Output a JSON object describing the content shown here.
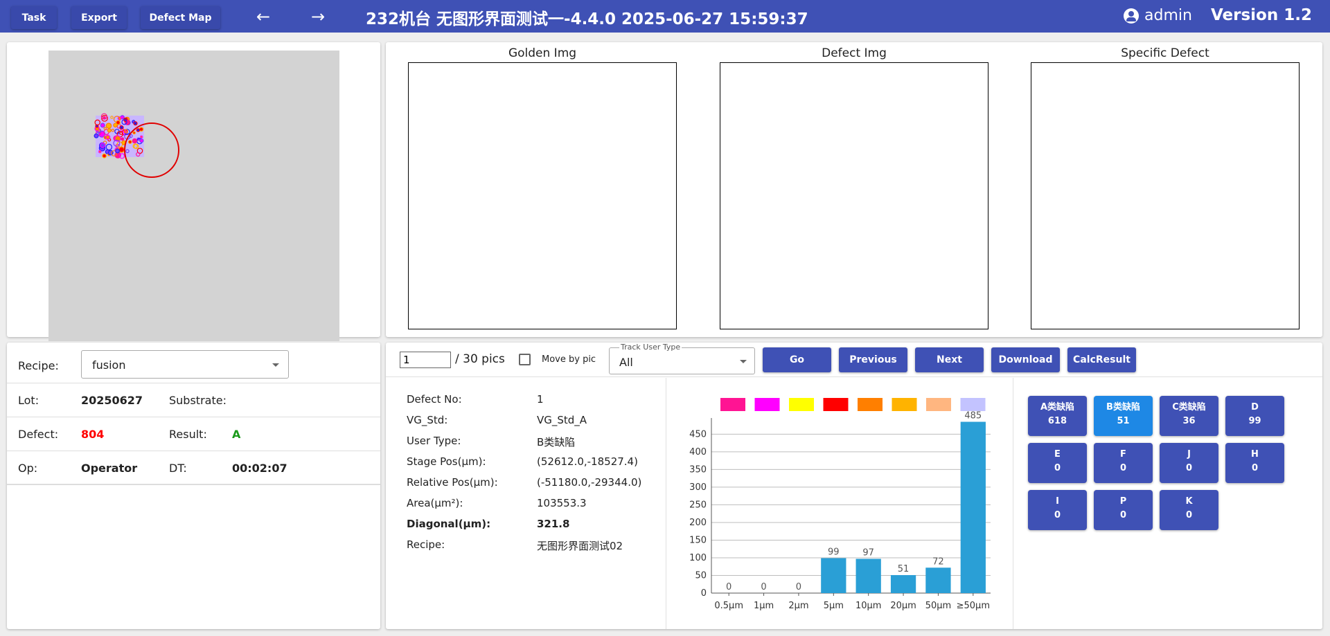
{
  "topbar": {
    "task_label": "Task",
    "export_label": "Export",
    "defect_map_label": "Defect Map",
    "title": "232机台   无图形界面测试一-4.4.0   2025-06-27 15:59:37",
    "user": "admin",
    "version": "Version 1.2",
    "color": "#3f51b5"
  },
  "images": {
    "golden": "Golden Img",
    "defect": "Defect Img",
    "specific": "Specific Defect"
  },
  "info": {
    "recipe_label": "Recipe:",
    "recipe_value": "fusion",
    "lot_label": "Lot:",
    "lot_value": "20250627",
    "substrate_label": "Substrate:",
    "substrate_value": "",
    "defect_label": "Defect:",
    "defect_value": "804",
    "result_label": "Result:",
    "result_value": "A",
    "op_label": "Op:",
    "op_value": "Operator",
    "dt_label": "DT:",
    "dt_value": "00:02:07"
  },
  "controls": {
    "page_value": "1",
    "pics_label": "/ 30 pics",
    "move_by_pic_label": "Move by pic",
    "track_user_type_label": "Track User Type",
    "track_user_type_value": "All",
    "go_label": "Go",
    "previous_label": "Previous",
    "next_label": "Next",
    "download_label": "Download",
    "calc_result_label": "CalcResult"
  },
  "details": [
    {
      "label": "Defect No:",
      "value": "1",
      "bold": false
    },
    {
      "label": "VG_Std:",
      "value": "VG_Std_A",
      "bold": false
    },
    {
      "label": "User Type:",
      "value": "B类缺陷",
      "bold": false
    },
    {
      "label": "Stage Pos(μm):",
      "value": "(52612.0,-18527.4)",
      "bold": false
    },
    {
      "label": "Relative Pos(μm):",
      "value": "(-51180.0,-29344.0)",
      "bold": false
    },
    {
      "label": "Area(μm²):",
      "value": "103553.3",
      "bold": false
    },
    {
      "label": "Diagonal(μm):",
      "value": "321.8",
      "bold": true
    },
    {
      "label": "Recipe:",
      "value": "无图形界面测试02",
      "bold": false
    }
  ],
  "legend_colors": [
    "#ff1493",
    "#ff00ff",
    "#ffff00",
    "#ff0000",
    "#ff7f00",
    "#ffb300",
    "#ffb680",
    "#c3c3ff"
  ],
  "chart_data": {
    "type": "bar",
    "categories": [
      "0.5μm",
      "1μm",
      "2μm",
      "5μm",
      "10μm",
      "20μm",
      "50μm",
      "≥50μm"
    ],
    "values": [
      0,
      0,
      0,
      99,
      97,
      51,
      72,
      485
    ],
    "yticks": [
      0,
      50,
      100,
      150,
      200,
      250,
      300,
      350,
      400,
      450
    ],
    "ylim": [
      0,
      500
    ],
    "bar_color": "#2a9fd6",
    "grid": true
  },
  "classes": [
    {
      "name": "A类缺陷",
      "count": "618",
      "active": false
    },
    {
      "name": "B类缺陷",
      "count": "51",
      "active": true
    },
    {
      "name": "C类缺陷",
      "count": "36",
      "active": false
    },
    {
      "name": "D",
      "count": "99",
      "active": false
    },
    {
      "name": "E",
      "count": "0",
      "active": false
    },
    {
      "name": "F",
      "count": "0",
      "active": false
    },
    {
      "name": "J",
      "count": "0",
      "active": false
    },
    {
      "name": "H",
      "count": "0",
      "active": false
    },
    {
      "name": "I",
      "count": "0",
      "active": false
    },
    {
      "name": "P",
      "count": "0",
      "active": false
    },
    {
      "name": "K",
      "count": "0",
      "active": false
    }
  ]
}
